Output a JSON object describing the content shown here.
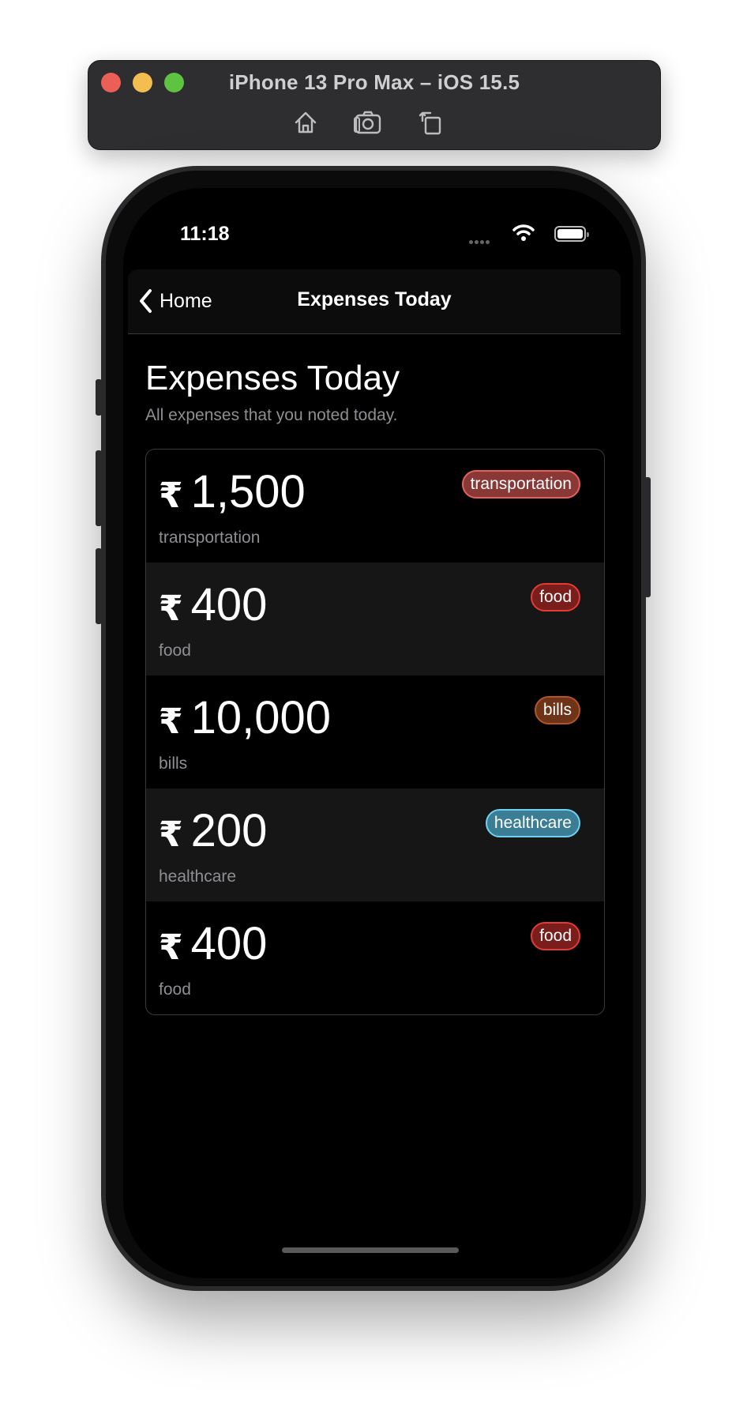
{
  "simulator": {
    "title": "iPhone 13 Pro Max – iOS 15.5",
    "tools": [
      {
        "name": "home-icon"
      },
      {
        "name": "screenshot-icon"
      },
      {
        "name": "rotate-icon"
      }
    ]
  },
  "status_bar": {
    "time": "11:18"
  },
  "nav": {
    "back_label": "Home",
    "title": "Expenses Today"
  },
  "header": {
    "title": "Expenses Today",
    "subtitle": "All expenses that you noted today."
  },
  "currency_symbol": "₹",
  "expenses": [
    {
      "amount": "1,500",
      "category": "transportation",
      "badge": "transportation",
      "badge_color": "#e8605a",
      "badge_bg": "#8a3836"
    },
    {
      "amount": "400",
      "category": "food",
      "badge": "food",
      "badge_color": "#e33b35",
      "badge_bg": "#7a1e1b"
    },
    {
      "amount": "10,000",
      "category": "bills",
      "badge": "bills",
      "badge_color": "#b5542a",
      "badge_bg": "#6e3418"
    },
    {
      "amount": "200",
      "category": "healthcare",
      "badge": "healthcare",
      "badge_color": "#6fd2f2",
      "badge_bg": "#3a7d95"
    },
    {
      "amount": "400",
      "category": "food",
      "badge": "food",
      "badge_color": "#e33b35",
      "badge_bg": "#7a1e1b"
    }
  ]
}
